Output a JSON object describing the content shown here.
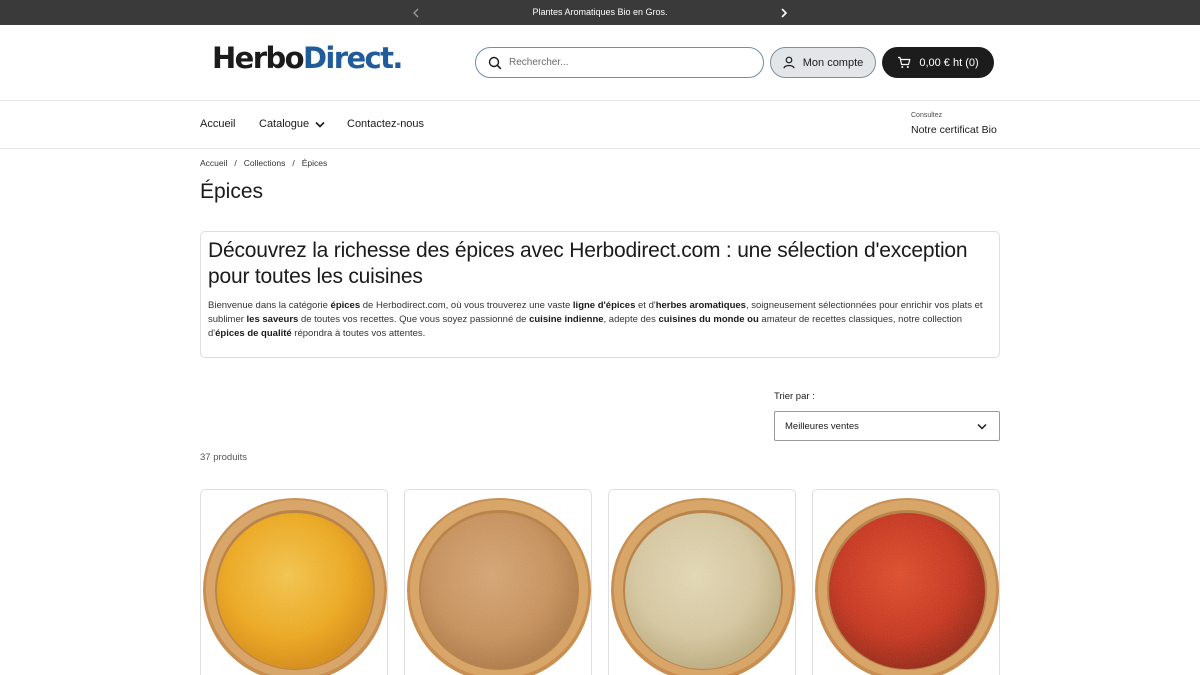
{
  "announcement": {
    "text": "Plantes Aromatiques Bio en Gros."
  },
  "header": {
    "logo": {
      "part1": "Herbo",
      "part2": "Direct."
    },
    "search": {
      "placeholder": "Rechercher..."
    },
    "account_label": "Mon compte",
    "cart_label": "0,00 € ht (0)"
  },
  "nav": {
    "items": [
      {
        "label": "Accueil"
      },
      {
        "label": "Catalogue"
      },
      {
        "label": "Contactez-nous"
      }
    ],
    "certificate": {
      "small": "Consultez",
      "main": "Notre certificat Bio"
    }
  },
  "breadcrumb": [
    "Accueil",
    "Collections",
    "Épices"
  ],
  "page_title": "Épices",
  "description": {
    "heading": "Découvrez la richesse des épices avec Herbodirect.com : une sélection d'exception pour toutes les cuisines",
    "paragraph_parts": [
      {
        "text": "Bienvenue dans la catégorie ",
        "bold": false
      },
      {
        "text": "épices",
        "bold": true
      },
      {
        "text": " de Herbodirect.com, où vous trouverez une vaste ",
        "bold": false
      },
      {
        "text": "ligne d'épices",
        "bold": true
      },
      {
        "text": " et d'",
        "bold": false
      },
      {
        "text": "herbes aromatiques",
        "bold": true
      },
      {
        "text": ", soigneusement sélectionnées pour enrichir vos plats et sublimer ",
        "bold": false
      },
      {
        "text": "les saveurs",
        "bold": true
      },
      {
        "text": " de toutes vos recettes. Que vous soyez passionné de ",
        "bold": false
      },
      {
        "text": "cuisine indienne",
        "bold": true
      },
      {
        "text": ", adepte des ",
        "bold": false
      },
      {
        "text": "cuisines du monde",
        "bold": true
      },
      {
        "text": " ",
        "bold": false
      },
      {
        "text": "ou",
        "bold": true
      },
      {
        "text": " amateur de recettes classiques, notre collection d'",
        "bold": false
      },
      {
        "text": "épices de qualité",
        "bold": true
      },
      {
        "text": " répondra à toutes vos attentes.",
        "bold": false
      }
    ]
  },
  "sort": {
    "label": "Trier par :",
    "selected": "Meilleures ventes"
  },
  "product_count": "37 produits",
  "products": [
    {
      "name": "curcuma-powder",
      "color": "#f0a91a",
      "highlight": "#f7c64a",
      "shadow": "#d98c10"
    },
    {
      "name": "cinnamon-powder",
      "color": "#c9915a",
      "highlight": "#d8a672",
      "shadow": "#b07a45"
    },
    {
      "name": "ginger-powder",
      "color": "#d8c9a0",
      "highlight": "#e6dab6",
      "shadow": "#bfae80"
    },
    {
      "name": "paprika-powder",
      "color": "#c8321a",
      "highlight": "#e04a26",
      "shadow": "#9a2410"
    }
  ],
  "colors": {
    "brand_blue": "#1f5c99",
    "dark": "#1c1c1c",
    "announce_bg": "#3a3a3a",
    "bowl_wood": "#d9a66a"
  }
}
